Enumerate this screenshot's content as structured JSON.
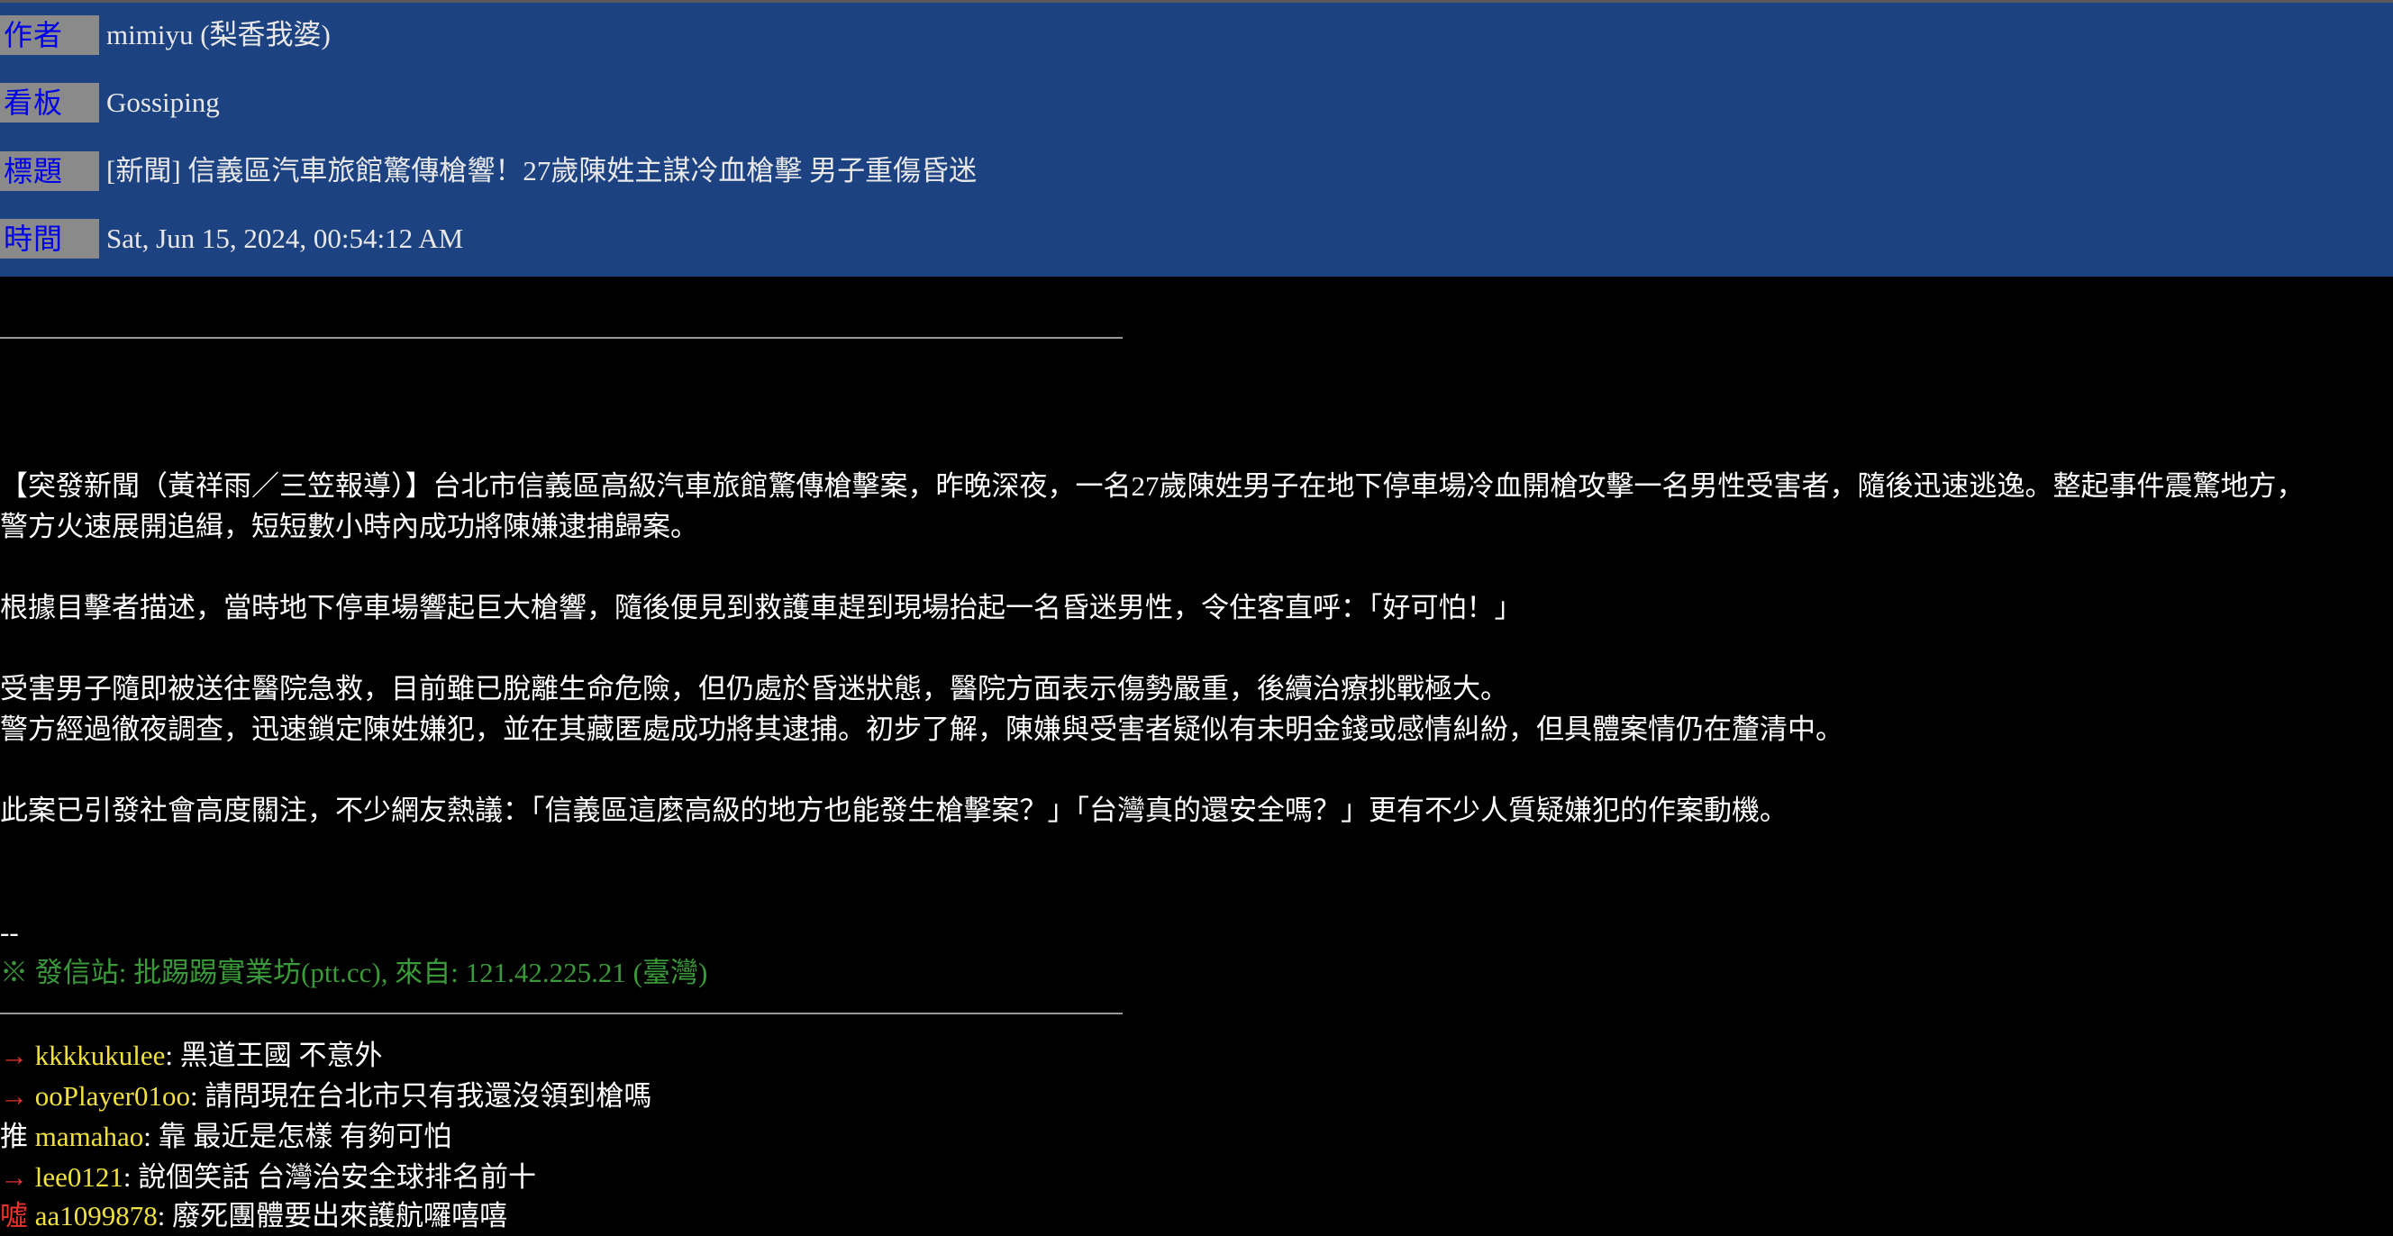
{
  "header": {
    "author_label": "作者",
    "author_value": "mimiyu (梨香我婆)",
    "board_label": "看板",
    "board_value": "Gossiping",
    "title_label": "標題",
    "title_value": "[新聞] 信義區汽車旅館驚傳槍響！27歲陳姓主謀冷血槍擊 男子重傷昏迷",
    "time_label": "時間",
    "time_value": "Sat, Jun 15, 2024, 00:54:12 AM"
  },
  "article": {
    "p1_line1": "【突發新聞（黃祥雨／三笠報導）】台北市信義區高級汽車旅館驚傳槍擊案，昨晚深夜，一名27歲陳姓男子在地下停車場冷血開槍攻擊一名男性受害者，隨後迅速逃逸。整起事件震驚地方，",
    "p1_line2": "警方火速展開追緝，短短數小時內成功將陳嫌逮捕歸案。",
    "p2": "根據目擊者描述，當時地下停車場響起巨大槍響，隨後便見到救護車趕到現場抬起一名昏迷男性，令住客直呼：「好可怕！」",
    "p3_line1": "受害男子隨即被送往醫院急救，目前雖已脫離生命危險，但仍處於昏迷狀態，醫院方面表示傷勢嚴重，後續治療挑戰極大。",
    "p3_line2": "警方經過徹夜調查，迅速鎖定陳姓嫌犯，並在其藏匿處成功將其逮捕。初步了解，陳嫌與受害者疑似有未明金錢或感情糾紛，但具體案情仍在釐清中。",
    "p4": "此案已引發社會高度關注，不少網友熱議：「信義區這麼高級的地方也能發生槍擊案？」「台灣真的還安全嗎？」更有不少人質疑嫌犯的作案動機。",
    "sig_dash": "--",
    "sig_line": "※ 發信站: 批踢踢實業坊(ptt.cc), 來自: 121.42.225.21 (臺灣)"
  },
  "pushes": [
    {
      "tag": "→",
      "user": "kkkkukulee",
      "content": ": 黑道王國 不意外"
    },
    {
      "tag": "→",
      "user": "ooPlayer01oo",
      "content": ": 請問現在台北市只有我還沒領到槍嗎"
    },
    {
      "tag": "推",
      "user": "mamahao",
      "content": ": 靠 最近是怎樣 有夠可怕"
    },
    {
      "tag": "→",
      "user": "lee0121",
      "content": ": 說個笑話 台灣治安全球排名前十"
    },
    {
      "tag": "噓",
      "user": "aa1099878",
      "content": ": 廢死團體要出來護航囉嘻嘻"
    }
  ],
  "colors": {
    "header_bg": "#1d4281",
    "label_bg": "#8a8a8a",
    "label_text": "#0000e6",
    "signature": "#3a9a3a",
    "push_user": "#f0e040",
    "push_tag_red": "#e8342b"
  }
}
